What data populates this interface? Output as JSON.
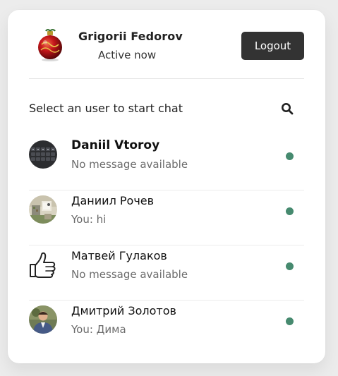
{
  "header": {
    "user_name": "Grigorii Fedorov",
    "status": "Active now",
    "logout_label": "Logout"
  },
  "search": {
    "prompt": "Select an user to start chat",
    "icon": "search-icon"
  },
  "colors": {
    "online": "#468a6f",
    "button_bg": "#333333"
  },
  "users": [
    {
      "name": "Daniil Vtoroy",
      "last_message": "No message available",
      "status": "online",
      "avatar": "keyboard-photo"
    },
    {
      "name": "Даниил Рочев",
      "last_message": "You: hi",
      "status": "online",
      "avatar": "room-photo"
    },
    {
      "name": "Матвей Гулаков",
      "last_message": "No message available",
      "status": "online",
      "avatar": "thumbs-up-icon"
    },
    {
      "name": "Дмитрий Золотов",
      "last_message": "You: Дима",
      "status": "online",
      "avatar": "person-photo"
    }
  ]
}
